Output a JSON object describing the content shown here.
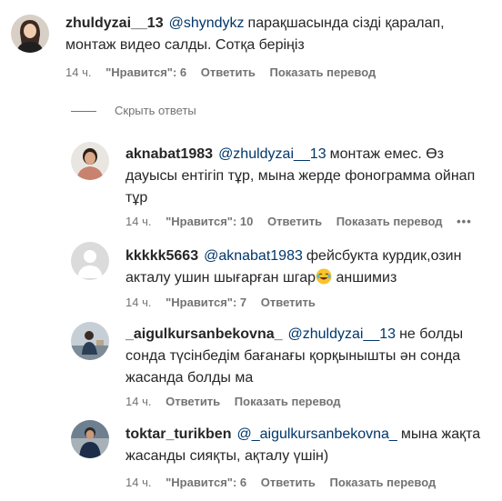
{
  "comments": [
    {
      "username": "zhuldyzai__13",
      "mention": "@shyndykz",
      "text": "парақшасында сізді қаралап, монтаж видео салды. Сотқа беріңіз",
      "time": "14 ч.",
      "likes": "\"Нравится\": 6",
      "reply": "Ответить",
      "translate": "Показать перевод"
    }
  ],
  "hide_replies": "Скрыть ответы",
  "replies": [
    {
      "username": "aknabat1983",
      "mention": "@zhuldyzai__13",
      "text": "монтаж емес. Өз дауысы ентігіп тұр, мына жерде фонограмма ойнап тұр",
      "time": "14 ч.",
      "likes": "\"Нравится\": 10",
      "reply": "Ответить",
      "translate": "Показать перевод",
      "more": "•••"
    },
    {
      "username": "kkkkk5663",
      "mention": "@aknabat1983",
      "text_before_emoji": "фейсбукта курдик,озин акталу ушин шығарған шгар",
      "text_after_emoji": "аншимиз",
      "emoji_icon": "laughing-face-icon",
      "time": "14 ч.",
      "likes": "\"Нравится\": 7",
      "reply": "Ответить"
    },
    {
      "username": "_aigulkursanbekovna_",
      "mention": "@zhuldyzai__13",
      "text": "не болды сонда түсінбедім бағанағы қорқынышты ән сонда жасанда болды ма",
      "time": "14 ч.",
      "reply": "Ответить",
      "translate": "Показать перевод"
    },
    {
      "username": "toktar_turikben",
      "mention": "@_aigulkursanbekovna_",
      "text": "мына жақта жасанды сияқты, ақталу үшін)",
      "time": "14 ч.",
      "likes": "\"Нравится\": 6",
      "reply": "Ответить",
      "translate": "Показать перевод"
    }
  ],
  "colors": {
    "text": "#262626",
    "mention": "#00376b",
    "meta": "#737373"
  }
}
